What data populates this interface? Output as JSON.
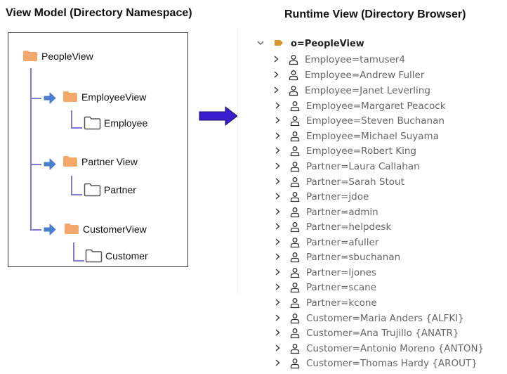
{
  "view_model": {
    "title": "View Model (Directory Namespace)",
    "nodes": {
      "root": "PeopleView",
      "employee_view": "EmployeeView",
      "employee": "Employee",
      "partner_view": "Partner View",
      "partner": "Partner",
      "customer_view": "CustomerView",
      "customer": "Customer"
    }
  },
  "arrow": {
    "icon": "right-arrow-icon",
    "color": "#3a1fd0"
  },
  "runtime_view": {
    "title": "Runtime View (Directory Browser)",
    "root": {
      "label": "o=PeopleView",
      "icon": "tag-icon",
      "expanded": true
    },
    "entries": [
      {
        "label": "Employee=tamuser4"
      },
      {
        "label": "Employee=Andrew Fuller"
      },
      {
        "label": "Employee=Janet Leverling"
      },
      {
        "label": "Employee=Margaret Peacock"
      },
      {
        "label": "Employee=Steven Buchanan"
      },
      {
        "label": "Employee=Michael Suyama"
      },
      {
        "label": "Employee=Robert King"
      },
      {
        "label": "Partner=Laura Callahan"
      },
      {
        "label": "Partner=Sarah Stout"
      },
      {
        "label": "Partner=jdoe"
      },
      {
        "label": "Partner=admin"
      },
      {
        "label": "Partner=helpdesk"
      },
      {
        "label": "Partner=afuller"
      },
      {
        "label": "Partner=sbuchanan"
      },
      {
        "label": "Partner=ljones"
      },
      {
        "label": "Partner=scane"
      },
      {
        "label": "Partner=kcone"
      },
      {
        "label": "Customer=Maria Anders {ALFKI}"
      },
      {
        "label": "Customer=Ana Trujillo {ANATR}"
      },
      {
        "label": "Customer=Antonio Moreno {ANTON}"
      },
      {
        "label": "Customer=Thomas Hardy {AROUT}"
      }
    ]
  },
  "colors": {
    "folder_filled": "#f4a86a",
    "tree_line": "#7b7bd6",
    "small_arrow": "#4a7fd0",
    "root_tag": "#d9962a"
  }
}
